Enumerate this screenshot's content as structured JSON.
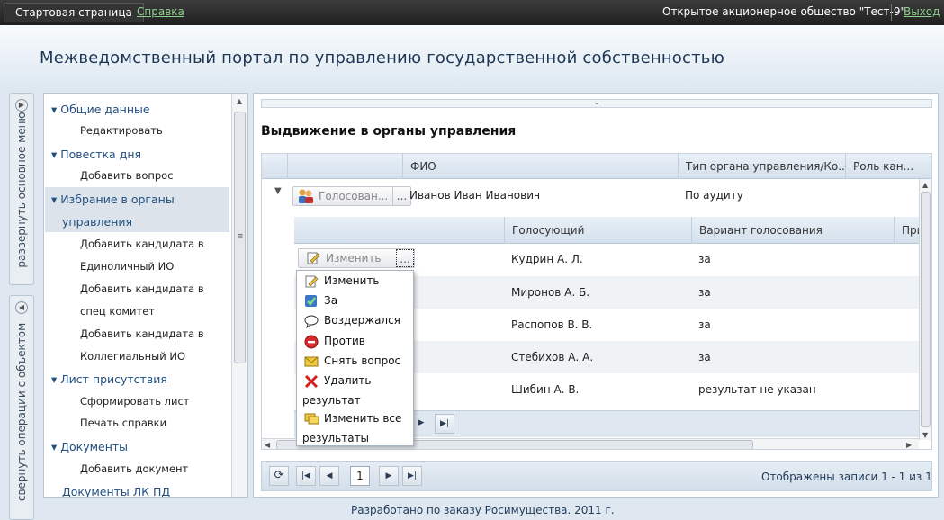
{
  "topbar": {
    "home": "Стартовая страница",
    "help": "Справка",
    "organization": "Открытое акционерное общество \"Тест-9\"",
    "exit": "Выход"
  },
  "header": {
    "title": "Межведомственный портал по управлению государственной собственностью"
  },
  "side_tabs": {
    "expand_menu": "развернуть основное меню",
    "collapse_ops": "свернуть операции с объектом"
  },
  "tree": {
    "groups": [
      {
        "label": "Общие данные",
        "children": [
          "Редактировать"
        ]
      },
      {
        "label": "Повестка дня",
        "children": [
          "Добавить вопрос"
        ]
      },
      {
        "label_line1": "Избрание в органы",
        "label_line2": "управления",
        "children": [
          "Добавить кандидата в",
          "Единоличный ИО",
          "Добавить кандидата в",
          "спец комитет",
          "Добавить кандидата в",
          "Коллегиальный ИО"
        ]
      },
      {
        "label": "Лист присутствия",
        "children": [
          "Сформировать лист",
          "Печать справки"
        ]
      },
      {
        "label": "Документы",
        "children": [
          "Добавить документ"
        ]
      }
    ],
    "last": "Документы ЛК ПД"
  },
  "main": {
    "section_title": "Выдвижение в органы управления",
    "columns": [
      "ФИО",
      "Тип органа управления/Ко...",
      "Роль кан..."
    ],
    "row": {
      "button_label": "Голосован...",
      "dots": "...",
      "name": "Иванов Иван Иванович",
      "type": "По аудиту"
    },
    "sub_columns": [
      "Голосующий",
      "Вариант голосования",
      "При"
    ],
    "sub_button": {
      "label": "Изменить",
      "dots": "..."
    },
    "sub_rows": [
      {
        "voter": "Кудрин А. Л.",
        "variant": "за"
      },
      {
        "voter": "Миронов А. Б.",
        "variant": "за"
      },
      {
        "voter": "Распопов В. В.",
        "variant": "за"
      },
      {
        "voter": "Стебихов А. А.",
        "variant": "за"
      },
      {
        "voter": "Шибин А. В.",
        "variant": "результат не указан"
      }
    ],
    "pager": {
      "page": "1",
      "info": "Отображены записи 1 - 1 из 1"
    }
  },
  "menu": {
    "items": [
      "Изменить",
      "За",
      "Воздержался",
      "Против",
      "Снять вопрос"
    ],
    "delete_line1": "Удалить",
    "delete_line2": "результат",
    "change_all_line1": "Изменить все",
    "change_all_line2": "результаты"
  },
  "footer": "Разработано по заказу Росимущества. 2011 г."
}
